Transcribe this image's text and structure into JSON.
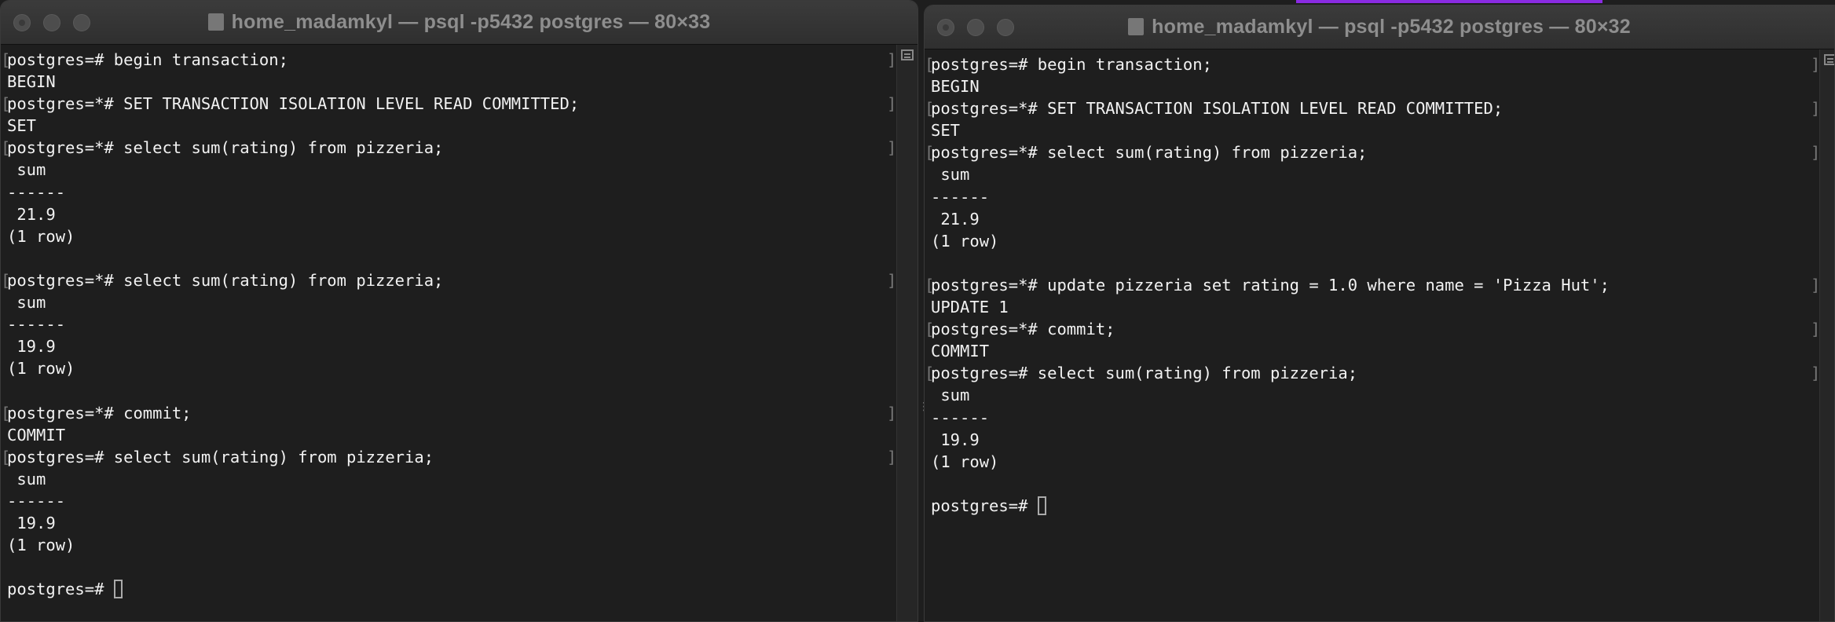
{
  "windows": [
    {
      "id": "left",
      "title": "home_madamkyl — psql -p5432 postgres — 80×33",
      "lines": [
        {
          "text": "postgres=# begin transaction;",
          "prompt": true
        },
        {
          "text": "BEGIN"
        },
        {
          "text": "postgres=*# SET TRANSACTION ISOLATION LEVEL READ COMMITTED;",
          "prompt": true
        },
        {
          "text": "SET"
        },
        {
          "text": "postgres=*# select sum(rating) from pizzeria;",
          "prompt": true
        },
        {
          "text": " sum"
        },
        {
          "text": "------"
        },
        {
          "text": " 21.9"
        },
        {
          "text": "(1 row)"
        },
        {
          "text": ""
        },
        {
          "text": "postgres=*# select sum(rating) from pizzeria;",
          "prompt": true
        },
        {
          "text": " sum"
        },
        {
          "text": "------"
        },
        {
          "text": " 19.9"
        },
        {
          "text": "(1 row)"
        },
        {
          "text": ""
        },
        {
          "text": "postgres=*# commit;",
          "prompt": true
        },
        {
          "text": "COMMIT"
        },
        {
          "text": "postgres=# select sum(rating) from pizzeria;",
          "prompt": true
        },
        {
          "text": " sum"
        },
        {
          "text": "------"
        },
        {
          "text": " 19.9"
        },
        {
          "text": "(1 row)"
        },
        {
          "text": ""
        },
        {
          "text": "postgres=# ",
          "cursor": true
        }
      ]
    },
    {
      "id": "right",
      "title": "home_madamkyl — psql -p5432 postgres — 80×32",
      "lines": [
        {
          "text": "postgres=# begin transaction;",
          "prompt": true
        },
        {
          "text": "BEGIN"
        },
        {
          "text": "postgres=*# SET TRANSACTION ISOLATION LEVEL READ COMMITTED;",
          "prompt": true
        },
        {
          "text": "SET"
        },
        {
          "text": "postgres=*# select sum(rating) from pizzeria;",
          "prompt": true
        },
        {
          "text": " sum"
        },
        {
          "text": "------"
        },
        {
          "text": " 21.9"
        },
        {
          "text": "(1 row)"
        },
        {
          "text": ""
        },
        {
          "text": "postgres=*# update pizzeria set rating = 1.0 where name = 'Pizza Hut';",
          "prompt": true
        },
        {
          "text": "UPDATE 1"
        },
        {
          "text": "postgres=*# commit;",
          "prompt": true
        },
        {
          "text": "COMMIT"
        },
        {
          "text": "postgres=# select sum(rating) from pizzeria;",
          "prompt": true
        },
        {
          "text": " sum"
        },
        {
          "text": "------"
        },
        {
          "text": " 19.9"
        },
        {
          "text": "(1 row)"
        },
        {
          "text": ""
        },
        {
          "text": "postgres=# ",
          "cursor": true
        }
      ]
    }
  ],
  "colors": {
    "background": "#1e1e1e",
    "titlebar": "#333333",
    "text": "#f2f2f2",
    "accent": "#8a2be2"
  }
}
